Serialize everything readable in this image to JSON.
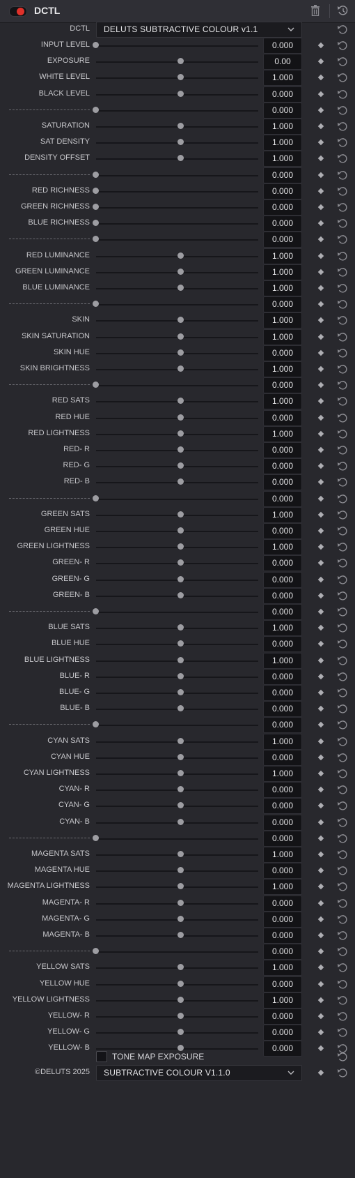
{
  "header": {
    "title": "DCTL"
  },
  "dctl_row": {
    "label": "DCTL",
    "selected": "DELUTS SUBTRACTIVE COLOUR v1.1"
  },
  "params": [
    {
      "label": "INPUT LEVEL",
      "value": "0.000",
      "slider": 0.0
    },
    {
      "label": "EXPOSURE",
      "value": "0.00",
      "slider": 0.5
    },
    {
      "label": "WHITE LEVEL",
      "value": "1.000",
      "slider": 0.5
    },
    {
      "label": "BLACK LEVEL",
      "value": "0.000",
      "slider": 0.5
    },
    {
      "label": "------------------------------------",
      "value": "0.000",
      "slider": 0.0,
      "sep": true
    },
    {
      "label": "SATURATION",
      "value": "1.000",
      "slider": 0.5
    },
    {
      "label": "SAT DENSITY",
      "value": "1.000",
      "slider": 0.5
    },
    {
      "label": "DENSITY OFFSET",
      "value": "1.000",
      "slider": 0.5
    },
    {
      "label": "------------------------------------",
      "value": "0.000",
      "slider": 0.0,
      "sep": true
    },
    {
      "label": "RED RICHNESS",
      "value": "0.000",
      "slider": 0.0
    },
    {
      "label": "GREEN RICHNESS",
      "value": "0.000",
      "slider": 0.0
    },
    {
      "label": "BLUE RICHNESS",
      "value": "0.000",
      "slider": 0.0
    },
    {
      "label": "------------------------------------",
      "value": "0.000",
      "slider": 0.0,
      "sep": true
    },
    {
      "label": "RED LUMINANCE",
      "value": "1.000",
      "slider": 0.5
    },
    {
      "label": "GREEN LUMINANCE",
      "value": "1.000",
      "slider": 0.5
    },
    {
      "label": "BLUE LUMINANCE",
      "value": "1.000",
      "slider": 0.5
    },
    {
      "label": "------------------------------------",
      "value": "0.000",
      "slider": 0.0,
      "sep": true
    },
    {
      "label": "SKIN",
      "value": "1.000",
      "slider": 0.5
    },
    {
      "label": "SKIN SATURATION",
      "value": "1.000",
      "slider": 0.5
    },
    {
      "label": "SKIN HUE",
      "value": "0.000",
      "slider": 0.5
    },
    {
      "label": "SKIN BRIGHTNESS",
      "value": "1.000",
      "slider": 0.5
    },
    {
      "label": "------------------------------------",
      "value": "0.000",
      "slider": 0.0,
      "sep": true
    },
    {
      "label": "RED SATS",
      "value": "1.000",
      "slider": 0.5
    },
    {
      "label": "RED HUE",
      "value": "0.000",
      "slider": 0.5
    },
    {
      "label": "RED LIGHTNESS",
      "value": "1.000",
      "slider": 0.5
    },
    {
      "label": "RED- R",
      "value": "0.000",
      "slider": 0.5
    },
    {
      "label": "RED- G",
      "value": "0.000",
      "slider": 0.5
    },
    {
      "label": "RED- B",
      "value": "0.000",
      "slider": 0.5
    },
    {
      "label": "------------------------------------",
      "value": "0.000",
      "slider": 0.0,
      "sep": true
    },
    {
      "label": "GREEN SATS",
      "value": "1.000",
      "slider": 0.5
    },
    {
      "label": "GREEN HUE",
      "value": "0.000",
      "slider": 0.5
    },
    {
      "label": "GREEN LIGHTNESS",
      "value": "1.000",
      "slider": 0.5
    },
    {
      "label": "GREEN- R",
      "value": "0.000",
      "slider": 0.5
    },
    {
      "label": "GREEN- G",
      "value": "0.000",
      "slider": 0.5
    },
    {
      "label": "GREEN- B",
      "value": "0.000",
      "slider": 0.5
    },
    {
      "label": "------------------------------------",
      "value": "0.000",
      "slider": 0.0,
      "sep": true
    },
    {
      "label": "BLUE SATS",
      "value": "1.000",
      "slider": 0.5
    },
    {
      "label": "BLUE HUE",
      "value": "0.000",
      "slider": 0.5
    },
    {
      "label": "BLUE LIGHTNESS",
      "value": "1.000",
      "slider": 0.5
    },
    {
      "label": "BLUE- R",
      "value": "0.000",
      "slider": 0.5
    },
    {
      "label": "BLUE- G",
      "value": "0.000",
      "slider": 0.5
    },
    {
      "label": "BLUE- B",
      "value": "0.000",
      "slider": 0.5
    },
    {
      "label": "------------------------------------",
      "value": "0.000",
      "slider": 0.0,
      "sep": true
    },
    {
      "label": "CYAN SATS",
      "value": "1.000",
      "slider": 0.5
    },
    {
      "label": "CYAN HUE",
      "value": "0.000",
      "slider": 0.5
    },
    {
      "label": "CYAN LIGHTNESS",
      "value": "1.000",
      "slider": 0.5
    },
    {
      "label": "CYAN- R",
      "value": "0.000",
      "slider": 0.5
    },
    {
      "label": "CYAN- G",
      "value": "0.000",
      "slider": 0.5
    },
    {
      "label": "CYAN- B",
      "value": "0.000",
      "slider": 0.5
    },
    {
      "label": "------------------------------------",
      "value": "0.000",
      "slider": 0.0,
      "sep": true
    },
    {
      "label": "MAGENTA SATS",
      "value": "1.000",
      "slider": 0.5
    },
    {
      "label": "MAGENTA HUE",
      "value": "0.000",
      "slider": 0.5
    },
    {
      "label": "MAGENTA LIGHTNESS",
      "value": "1.000",
      "slider": 0.5
    },
    {
      "label": "MAGENTA- R",
      "value": "0.000",
      "slider": 0.5
    },
    {
      "label": "MAGENTA- G",
      "value": "0.000",
      "slider": 0.5
    },
    {
      "label": "MAGENTA- B",
      "value": "0.000",
      "slider": 0.5
    },
    {
      "label": "------------------------------------",
      "value": "0.000",
      "slider": 0.0,
      "sep": true
    },
    {
      "label": "YELLOW SATS",
      "value": "1.000",
      "slider": 0.5
    },
    {
      "label": "YELLOW HUE",
      "value": "0.000",
      "slider": 0.5
    },
    {
      "label": "YELLOW LIGHTNESS",
      "value": "1.000",
      "slider": 0.5
    },
    {
      "label": "YELLOW- R",
      "value": "0.000",
      "slider": 0.5
    },
    {
      "label": "YELLOW- G",
      "value": "0.000",
      "slider": 0.5
    },
    {
      "label": "YELLOW- B",
      "value": "0.000",
      "slider": 0.5
    }
  ],
  "tone_map": {
    "label": "TONE MAP EXPOSURE",
    "checked": false
  },
  "footer": {
    "label": "©DELUTS 2025",
    "selected": "SUBTRACTIVE COLOUR V1.1.0"
  },
  "colors": {
    "toggle_on": "#e0312a",
    "panel_bg": "#28282d",
    "field_bg": "#131316"
  },
  "icons": {
    "trash": "trash-icon",
    "reset": "reset-icon",
    "keyframe": "keyframe-icon",
    "dropdown": "chevron-down-icon"
  }
}
